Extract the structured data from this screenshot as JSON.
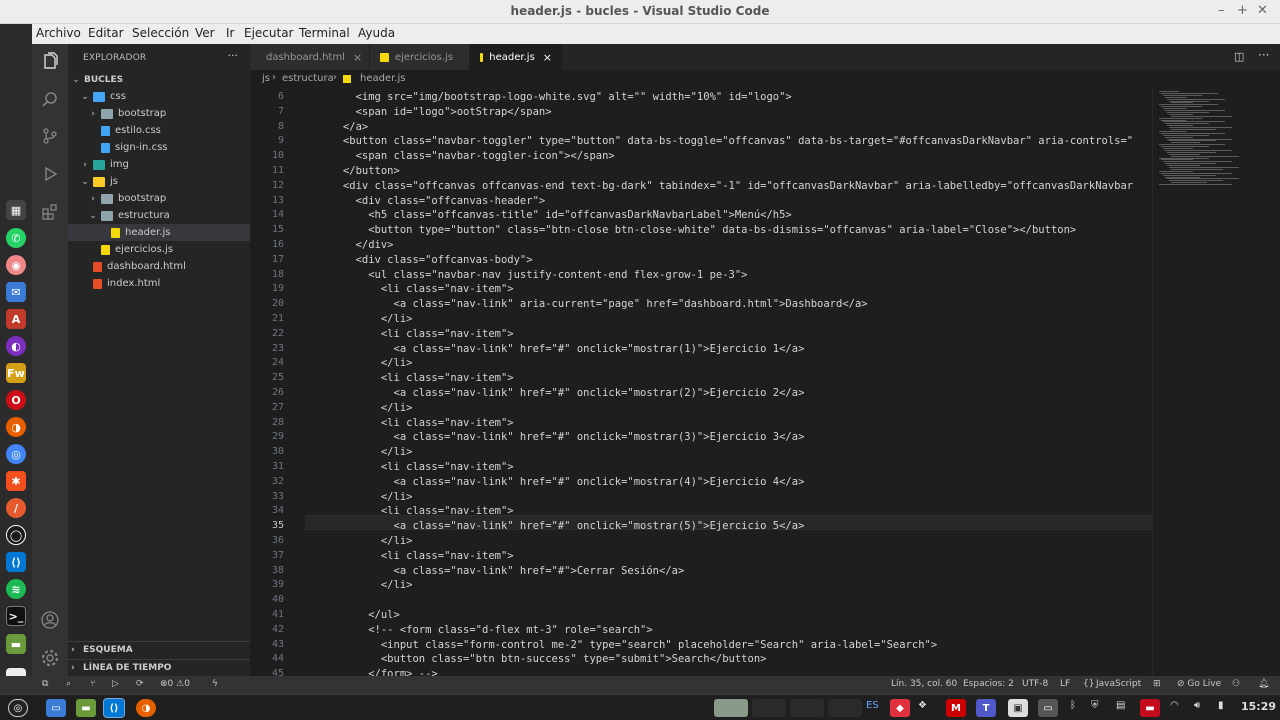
{
  "window": {
    "title": "header.js - bucles - Visual Studio Code"
  },
  "menu": [
    "Archivo",
    "Editar",
    "Selección",
    "Ver",
    "Ir",
    "Ejecutar",
    "Terminal",
    "Ayuda"
  ],
  "explorer": {
    "header": "EXPLORADOR",
    "more": "···",
    "root": "BUCLES",
    "items": [
      {
        "label": "css"
      },
      {
        "label": "bootstrap"
      },
      {
        "label": "estilo.css"
      },
      {
        "label": "sign-in.css"
      },
      {
        "label": "img"
      },
      {
        "label": "js"
      },
      {
        "label": "bootstrap"
      },
      {
        "label": "estructura"
      },
      {
        "label": "header.js"
      },
      {
        "label": "ejercicios.js"
      },
      {
        "label": "dashboard.html"
      },
      {
        "label": "index.html"
      }
    ],
    "sections": [
      "ESQUEMA",
      "LÍNEA DE TIEMPO"
    ]
  },
  "tabs": [
    {
      "label": "dashboard.html"
    },
    {
      "label": "ejercicios.js"
    },
    {
      "label": "header.js"
    }
  ],
  "breadcrumb": [
    "js",
    "estructura",
    "header.js"
  ],
  "editor": {
    "lines": [
      {
        "n": "6",
        "code": "        <img src=\"img/bootstrap-logo-white.svg\" alt=\"\" width=\"10%\" id=\"logo\">"
      },
      {
        "n": "7",
        "code": "        <span id=\"logo\">ootStrap</span>"
      },
      {
        "n": "8",
        "code": "      </a>"
      },
      {
        "n": "9",
        "code": "      <button class=\"navbar-toggler\" type=\"button\" data-bs-toggle=\"offcanvas\" data-bs-target=\"#offcanvasDarkNavbar\" aria-controls=\""
      },
      {
        "n": "10",
        "code": "        <span class=\"navbar-toggler-icon\"></span>"
      },
      {
        "n": "11",
        "code": "      </button>"
      },
      {
        "n": "12",
        "code": "      <div class=\"offcanvas offcanvas-end text-bg-dark\" tabindex=\"-1\" id=\"offcanvasDarkNavbar\" aria-labelledby=\"offcanvasDarkNavbar"
      },
      {
        "n": "13",
        "code": "        <div class=\"offcanvas-header\">"
      },
      {
        "n": "14",
        "code": "          <h5 class=\"offcanvas-title\" id=\"offcanvasDarkNavbarLabel\">Menú</h5>"
      },
      {
        "n": "15",
        "code": "          <button type=\"button\" class=\"btn-close btn-close-white\" data-bs-dismiss=\"offcanvas\" aria-label=\"Close\"></button>"
      },
      {
        "n": "16",
        "code": "        </div>"
      },
      {
        "n": "17",
        "code": "        <div class=\"offcanvas-body\">"
      },
      {
        "n": "18",
        "code": "          <ul class=\"navbar-nav justify-content-end flex-grow-1 pe-3\">"
      },
      {
        "n": "19",
        "code": "            <li class=\"nav-item\">"
      },
      {
        "n": "20",
        "code": "              <a class=\"nav-link\" aria-current=\"page\" href=\"dashboard.html\">Dashboard</a>"
      },
      {
        "n": "21",
        "code": "            </li>"
      },
      {
        "n": "22",
        "code": "            <li class=\"nav-item\">"
      },
      {
        "n": "23",
        "code": "              <a class=\"nav-link\" href=\"#\" onclick=\"mostrar(1)\">Ejercicio 1</a>"
      },
      {
        "n": "24",
        "code": "            </li>"
      },
      {
        "n": "25",
        "code": "            <li class=\"nav-item\">"
      },
      {
        "n": "26",
        "code": "              <a class=\"nav-link\" href=\"#\" onclick=\"mostrar(2)\">Ejercicio 2</a>"
      },
      {
        "n": "27",
        "code": "            </li>"
      },
      {
        "n": "28",
        "code": "            <li class=\"nav-item\">"
      },
      {
        "n": "29",
        "code": "              <a class=\"nav-link\" href=\"#\" onclick=\"mostrar(3)\">Ejercicio 3</a>"
      },
      {
        "n": "30",
        "code": "            </li>"
      },
      {
        "n": "31",
        "code": "            <li class=\"nav-item\">"
      },
      {
        "n": "32",
        "code": "              <a class=\"nav-link\" href=\"#\" onclick=\"mostrar(4)\">Ejercicio 4</a>"
      },
      {
        "n": "33",
        "code": "            </li>"
      },
      {
        "n": "34",
        "code": "            <li class=\"nav-item\">"
      },
      {
        "n": "35",
        "code": "              <a class=\"nav-link\" href=\"#\" onclick=\"mostrar(5)\">Ejercicio 5</a>"
      },
      {
        "n": "36",
        "code": "            </li>"
      },
      {
        "n": "37",
        "code": "            <li class=\"nav-item\">"
      },
      {
        "n": "38",
        "code": "              <a class=\"nav-link\" href=\"#\">Cerrar Sesión</a>"
      },
      {
        "n": "39",
        "code": "            </li>"
      },
      {
        "n": "40",
        "code": ""
      },
      {
        "n": "41",
        "code": "          </ul>"
      },
      {
        "n": "42",
        "code": "          <!-- <form class=\"d-flex mt-3\" role=\"search\">"
      },
      {
        "n": "43",
        "code": "            <input class=\"form-control me-2\" type=\"search\" placeholder=\"Search\" aria-label=\"Search\">"
      },
      {
        "n": "44",
        "code": "            <button class=\"btn btn-success\" type=\"submit\">Search</button>"
      },
      {
        "n": "45",
        "code": "          </form> -->"
      }
    ]
  },
  "status": {
    "problems": "0",
    "warnings": "0",
    "position": "Lín. 35, col. 60",
    "spaces": "Espacios: 2",
    "encoding": "UTF-8",
    "eol": "LF",
    "language": "JavaScript",
    "golive": "Go Live"
  },
  "taskbar": {
    "lang": "ES",
    "clock": "15:29"
  }
}
